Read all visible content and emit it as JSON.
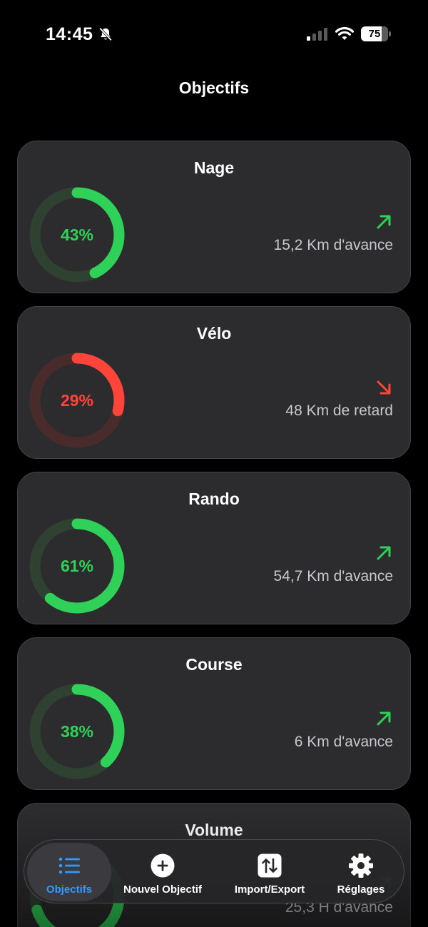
{
  "status_bar": {
    "time": "14:45",
    "battery": "75",
    "battery_level": 0.75
  },
  "page_title": "Objectifs",
  "colors": {
    "green": "#30d158",
    "red": "#ff453a",
    "blue": "#2f9bff",
    "card": "#2c2c2e"
  },
  "goals": [
    {
      "title": "Nage",
      "percent": 43,
      "percent_label": "43%",
      "status": "ahead",
      "trend_icon": "arrow-up-right-icon",
      "trend_text": "15,2 Km d'avance"
    },
    {
      "title": "Vélo",
      "percent": 29,
      "percent_label": "29%",
      "status": "behind",
      "trend_icon": "arrow-down-right-icon",
      "trend_text": "48 Km de retard"
    },
    {
      "title": "Rando",
      "percent": 61,
      "percent_label": "61%",
      "status": "ahead",
      "trend_icon": "arrow-up-right-icon",
      "trend_text": "54,7 Km d'avance"
    },
    {
      "title": "Course",
      "percent": 38,
      "percent_label": "38%",
      "status": "ahead",
      "trend_icon": "arrow-up-right-icon",
      "trend_text": "6 Km d'avance"
    },
    {
      "title": "Volume",
      "percent": 70,
      "percent_label": "",
      "status": "ahead",
      "trend_icon": "arrow-up-right-icon",
      "trend_text": "25,3 H d'avance"
    }
  ],
  "tabbar": {
    "tabs": [
      {
        "label": "Objectifs",
        "icon": "list-icon",
        "active": true
      },
      {
        "label": "Nouvel Objectif",
        "icon": "plus-circle-icon",
        "active": false
      },
      {
        "label": "Import/Export",
        "icon": "import-export-icon",
        "active": false
      },
      {
        "label": "Réglages",
        "icon": "gear-icon",
        "active": false
      }
    ]
  }
}
